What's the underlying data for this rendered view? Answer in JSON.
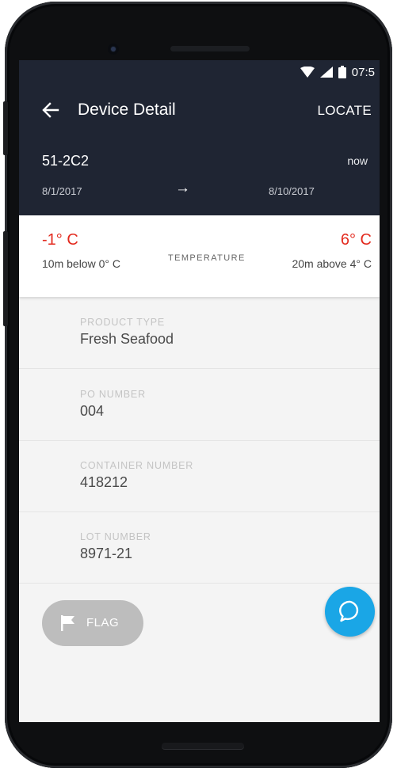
{
  "status_bar": {
    "time": "07:5",
    "icons": [
      "wifi-icon",
      "signal-icon",
      "battery-icon"
    ]
  },
  "header": {
    "title": "Device Detail",
    "locate_label": "LOCATE",
    "device_id": "51-2C2",
    "last_update": "now",
    "date_start": "8/1/2017",
    "date_arrow": "→",
    "date_end": "8/10/2017",
    "background_color": "#1f2533"
  },
  "temperature": {
    "label": "TEMPERATURE",
    "low_value": "-1° C",
    "low_note": "10m below 0° C",
    "high_value": "6° C",
    "high_note": "20m above 4° C",
    "alert_color": "#e32a1e"
  },
  "fields": [
    {
      "label": "PRODUCT TYPE",
      "value": "Fresh Seafood"
    },
    {
      "label": "PO NUMBER",
      "value": "004"
    },
    {
      "label": "CONTAINER NUMBER",
      "value": "418212"
    },
    {
      "label": "LOT NUMBER",
      "value": "8971-21"
    }
  ],
  "actions": {
    "flag_label": "FLAG",
    "chat_color": "#1aa6e6"
  }
}
